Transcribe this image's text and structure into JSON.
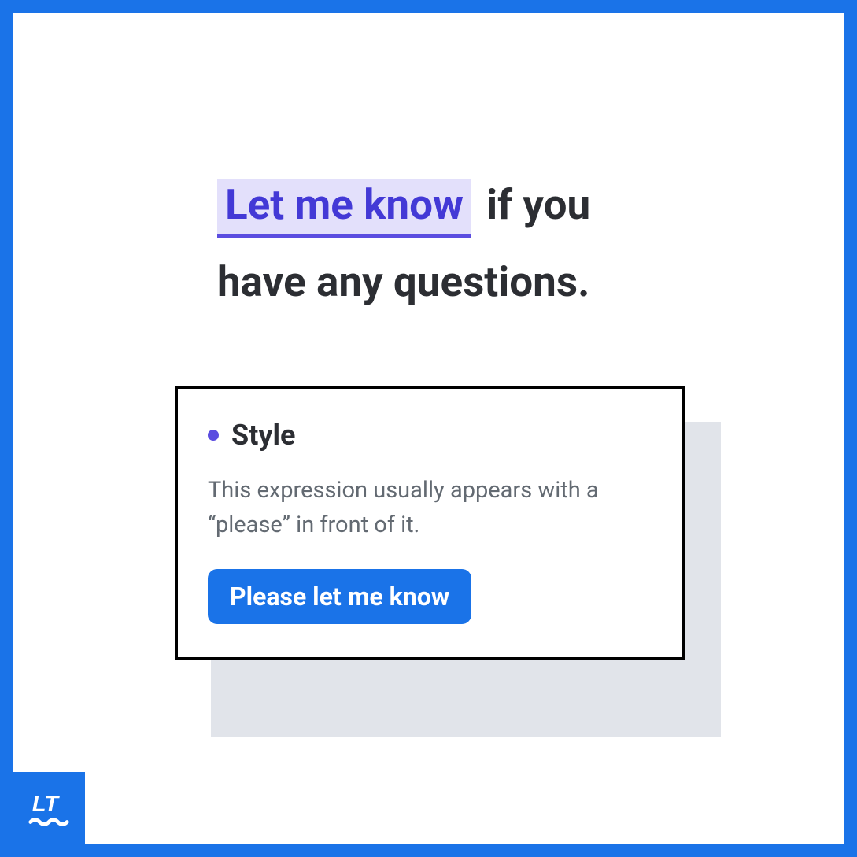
{
  "sentence": {
    "highlighted": "Let me know",
    "rest": " if you have any questions."
  },
  "popup": {
    "category": "Style",
    "explanation": "This expression usually appears with a “please” in front of it.",
    "suggestion": "Please let me know"
  },
  "brand": {
    "logo_text": "LT"
  },
  "colors": {
    "frame_border": "#1a73e8",
    "highlight_bg": "#e3e0fb",
    "highlight_text": "#4339d6",
    "highlight_underline": "#5b4de0",
    "bullet": "#5b4de0",
    "button_bg": "#1a73e8"
  }
}
